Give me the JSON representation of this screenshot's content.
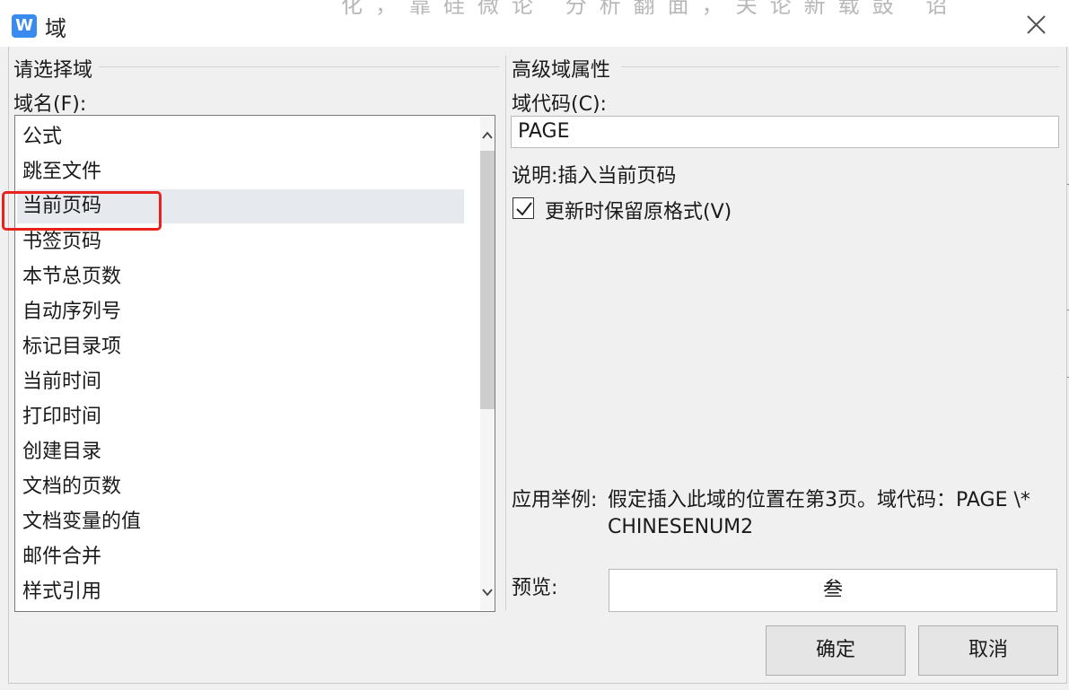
{
  "window": {
    "app_icon_letter": "W",
    "title": "域",
    "background_document_text": "化，靠硅微论 分析翻面，关论新载鼓 诏"
  },
  "left_panel": {
    "group_title": "请选择域",
    "field_label": "域名(F):",
    "items": [
      {
        "label": "公式"
      },
      {
        "label": "跳至文件"
      },
      {
        "label": "当前页码"
      },
      {
        "label": "书签页码"
      },
      {
        "label": "本节总页数"
      },
      {
        "label": "自动序列号"
      },
      {
        "label": "标记目录项"
      },
      {
        "label": "当前时间"
      },
      {
        "label": "打印时间"
      },
      {
        "label": "创建目录"
      },
      {
        "label": "文档的页数"
      },
      {
        "label": "文档变量的值"
      },
      {
        "label": "邮件合并"
      },
      {
        "label": "样式引用"
      }
    ],
    "selected_item": "当前页码"
  },
  "right_panel": {
    "group_title": "高级域属性",
    "code_label": "域代码(C):",
    "code_value": "PAGE",
    "description": "说明:插入当前页码",
    "checkbox_label": "更新时保留原格式(V)",
    "checkbox_checked": true,
    "example_label": "应用举例:",
    "example_text": "假定插入此域的位置在第3页。域代码：PAGE \\* CHINESENUM2",
    "preview_label": "预览:",
    "preview_value": "叁"
  },
  "buttons": {
    "ok": "确定",
    "cancel": "取消"
  },
  "colors": {
    "accent_icon": "#3a8bf0",
    "highlight_annotation": "#e8221c",
    "selection_background": "#e6e9ee"
  }
}
